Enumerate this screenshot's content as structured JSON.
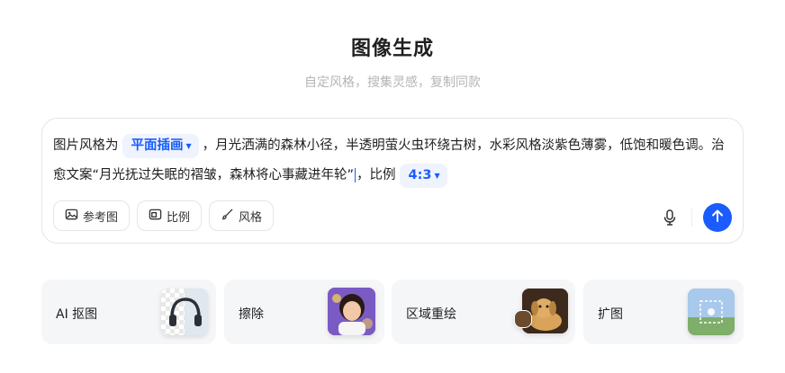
{
  "header": {
    "title": "图像生成",
    "subtitle": "自定风格，搜集灵感，复制同款"
  },
  "prompt": {
    "prefix": "图片风格为",
    "style_chip": "平面插画",
    "body": "，月光洒满的森林小径，半透明萤火虫环绕古树，水彩风格淡紫色薄雾，低饱和暖色调。治愈文案“月光抚过失眠的褶皱，森林将心事藏进年轮”",
    "ratio_prefix": "，比例",
    "ratio_chip": "4:3"
  },
  "toolbar": {
    "reference_label": "参考图",
    "ratio_label": "比例",
    "style_label": "风格",
    "reference_icon": "image-icon",
    "ratio_icon": "aspect-ratio-icon",
    "style_icon": "brush-icon",
    "mic_icon": "microphone-icon",
    "send_icon": "arrow-up-icon"
  },
  "cards": [
    {
      "label": "AI 抠图",
      "thumb_icon": "headphones-thumbnail"
    },
    {
      "label": "擦除",
      "thumb_icon": "girl-portrait-thumbnail"
    },
    {
      "label": "区域重绘",
      "thumb_icon": "dog-thumbnail"
    },
    {
      "label": "扩图",
      "thumb_icon": "landscape-thumbnail"
    }
  ],
  "colors": {
    "accent": "#1a5cff",
    "chip_bg": "#eef3fe",
    "card_bg": "#f5f6f8",
    "subtitle": "#b5b5b5"
  }
}
